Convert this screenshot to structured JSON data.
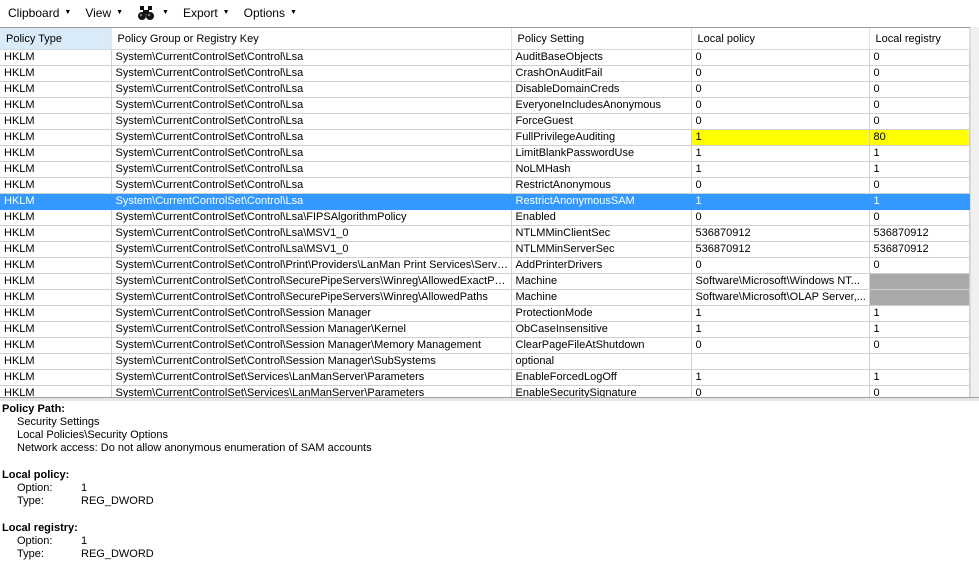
{
  "toolbar": {
    "clipboard": "Clipboard",
    "view": "View",
    "find_icon": "binoculars-icon",
    "export": "Export",
    "options": "Options"
  },
  "table": {
    "columns": [
      "Policy Type",
      "Policy Group or Registry Key",
      "Policy Setting",
      "Local policy",
      "Local registry"
    ],
    "rows": [
      [
        "HKLM",
        "System\\CurrentControlSet\\Control\\Lsa",
        "AuditBaseObjects",
        "0",
        "0"
      ],
      [
        "HKLM",
        "System\\CurrentControlSet\\Control\\Lsa",
        "CrashOnAuditFail",
        "0",
        "0"
      ],
      [
        "HKLM",
        "System\\CurrentControlSet\\Control\\Lsa",
        "DisableDomainCreds",
        "0",
        "0"
      ],
      [
        "HKLM",
        "System\\CurrentControlSet\\Control\\Lsa",
        "EveryoneIncludesAnonymous",
        "0",
        "0"
      ],
      [
        "HKLM",
        "System\\CurrentControlSet\\Control\\Lsa",
        "ForceGuest",
        "0",
        "0"
      ],
      [
        "HKLM",
        "System\\CurrentControlSet\\Control\\Lsa",
        "FullPrivilegeAuditing",
        "1",
        "80"
      ],
      [
        "HKLM",
        "System\\CurrentControlSet\\Control\\Lsa",
        "LimitBlankPasswordUse",
        "1",
        "1"
      ],
      [
        "HKLM",
        "System\\CurrentControlSet\\Control\\Lsa",
        "NoLMHash",
        "1",
        "1"
      ],
      [
        "HKLM",
        "System\\CurrentControlSet\\Control\\Lsa",
        "RestrictAnonymous",
        "0",
        "0"
      ],
      [
        "HKLM",
        "System\\CurrentControlSet\\Control\\Lsa",
        "RestrictAnonymousSAM",
        "1",
        "1"
      ],
      [
        "HKLM",
        "System\\CurrentControlSet\\Control\\Lsa\\FIPSAlgorithmPolicy",
        "Enabled",
        "0",
        "0"
      ],
      [
        "HKLM",
        "System\\CurrentControlSet\\Control\\Lsa\\MSV1_0",
        "NTLMMinClientSec",
        "536870912",
        "536870912"
      ],
      [
        "HKLM",
        "System\\CurrentControlSet\\Control\\Lsa\\MSV1_0",
        "NTLMMinServerSec",
        "536870912",
        "536870912"
      ],
      [
        "HKLM",
        "System\\CurrentControlSet\\Control\\Print\\Providers\\LanMan Print Services\\Servers",
        "AddPrinterDrivers",
        "0",
        "0"
      ],
      [
        "HKLM",
        "System\\CurrentControlSet\\Control\\SecurePipeServers\\Winreg\\AllowedExactPaths",
        "Machine",
        "Software\\Microsoft\\Windows NT...",
        ""
      ],
      [
        "HKLM",
        "System\\CurrentControlSet\\Control\\SecurePipeServers\\Winreg\\AllowedPaths",
        "Machine",
        "Software\\Microsoft\\OLAP Server,...",
        ""
      ],
      [
        "HKLM",
        "System\\CurrentControlSet\\Control\\Session Manager",
        "ProtectionMode",
        "1",
        "1"
      ],
      [
        "HKLM",
        "System\\CurrentControlSet\\Control\\Session Manager\\Kernel",
        "ObCaseInsensitive",
        "1",
        "1"
      ],
      [
        "HKLM",
        "System\\CurrentControlSet\\Control\\Session Manager\\Memory Management",
        "ClearPageFileAtShutdown",
        "0",
        "0"
      ],
      [
        "HKLM",
        "System\\CurrentControlSet\\Control\\Session Manager\\SubSystems",
        "optional",
        "",
        ""
      ],
      [
        "HKLM",
        "System\\CurrentControlSet\\Services\\LanManServer\\Parameters",
        "EnableForcedLogOff",
        "1",
        "1"
      ],
      [
        "HKLM",
        "System\\CurrentControlSet\\Services\\LanManServer\\Parameters",
        "EnableSecuritySignature",
        "0",
        "0"
      ]
    ],
    "highlighted_row": 5,
    "selected_row": 9,
    "gray_cells": [
      14,
      15
    ],
    "highlight_color": "#ffff00",
    "selection_color": "#3399ff"
  },
  "details": {
    "path_heading": "Policy Path:",
    "path_lines": [
      "Security Settings",
      "Local Policies\\Security Options",
      "Network access: Do not allow anonymous enumeration of SAM accounts"
    ],
    "local_policy_heading": "Local policy:",
    "local_policy_option_label": "Option:",
    "local_policy_option": "1",
    "local_policy_type_label": "Type:",
    "local_policy_type": "REG_DWORD",
    "local_registry_heading": "Local registry:",
    "local_registry_option_label": "Option:",
    "local_registry_option": "1",
    "local_registry_type_label": "Type:",
    "local_registry_type": "REG_DWORD"
  }
}
